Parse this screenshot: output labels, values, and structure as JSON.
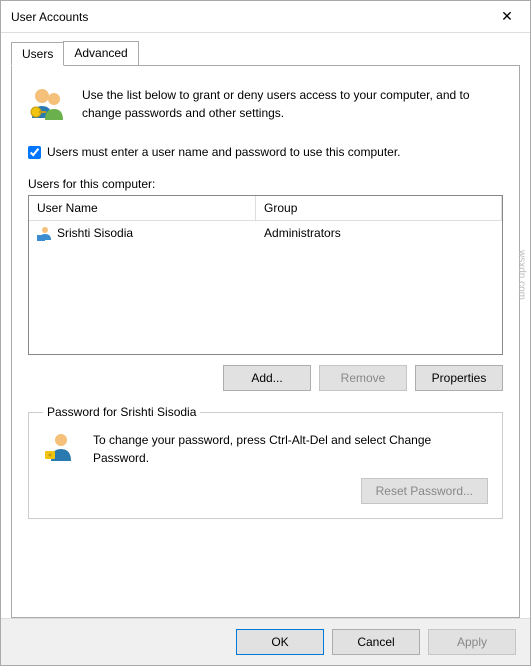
{
  "window": {
    "title": "User Accounts",
    "close_x": "✕"
  },
  "tabs": {
    "users": "Users",
    "advanced": "Advanced"
  },
  "intro": "Use the list below to grant or deny users access to your computer, and to change passwords and other settings.",
  "checkbox": {
    "label": "Users must enter a user name and password to use this computer.",
    "checked": true
  },
  "list": {
    "title": "Users for this computer:",
    "columns": {
      "name": "User Name",
      "group": "Group"
    },
    "rows": [
      {
        "name": "Srishti Sisodia",
        "group": "Administrators"
      }
    ]
  },
  "buttons": {
    "add": "Add...",
    "remove": "Remove",
    "properties": "Properties"
  },
  "password_group": {
    "legend": "Password for Srishti Sisodia",
    "text": "To change your password, press Ctrl-Alt-Del and select Change Password.",
    "reset": "Reset Password..."
  },
  "dialog": {
    "ok": "OK",
    "cancel": "Cancel",
    "apply": "Apply"
  },
  "watermark": "wsxdn.com"
}
